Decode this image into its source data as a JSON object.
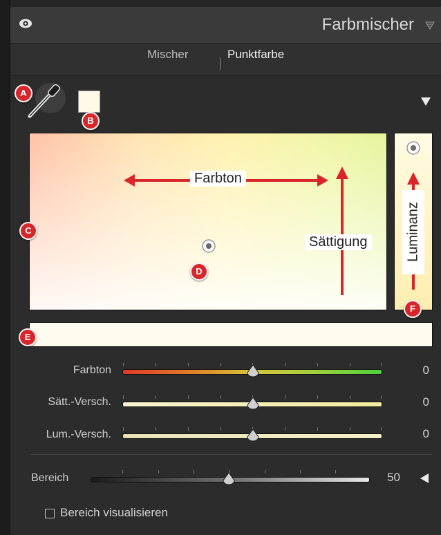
{
  "panel": {
    "title": "Farbmischer",
    "eye_icon": "eye-icon",
    "menu_icon": "triangle-menu-icon"
  },
  "tabs": [
    {
      "label": "Mischer",
      "active": false
    },
    {
      "label": "Punktfarbe",
      "active": true
    }
  ],
  "badges": {
    "a": "A",
    "b": "B",
    "c": "C",
    "d": "D",
    "e": "E",
    "f": "F"
  },
  "annotations": {
    "hue": "Farbton",
    "saturation": "Sättigung",
    "luminance": "Luminanz"
  },
  "sliders": [
    {
      "label": "Farbton",
      "value": "0",
      "position": 0.5
    },
    {
      "label": "Sätt.-Versch.",
      "value": "0",
      "position": 0.5
    },
    {
      "label": "Lum.-Versch.",
      "value": "0",
      "position": 0.5
    }
  ],
  "range": {
    "label": "Bereich",
    "value": "50",
    "position": 0.5
  },
  "checkbox": {
    "label": "Bereich visualisieren",
    "checked": false
  },
  "colors": {
    "accent_red": "#d8262a",
    "picked_swatch": "#fff9e8",
    "target_strip": "#fffbee"
  }
}
